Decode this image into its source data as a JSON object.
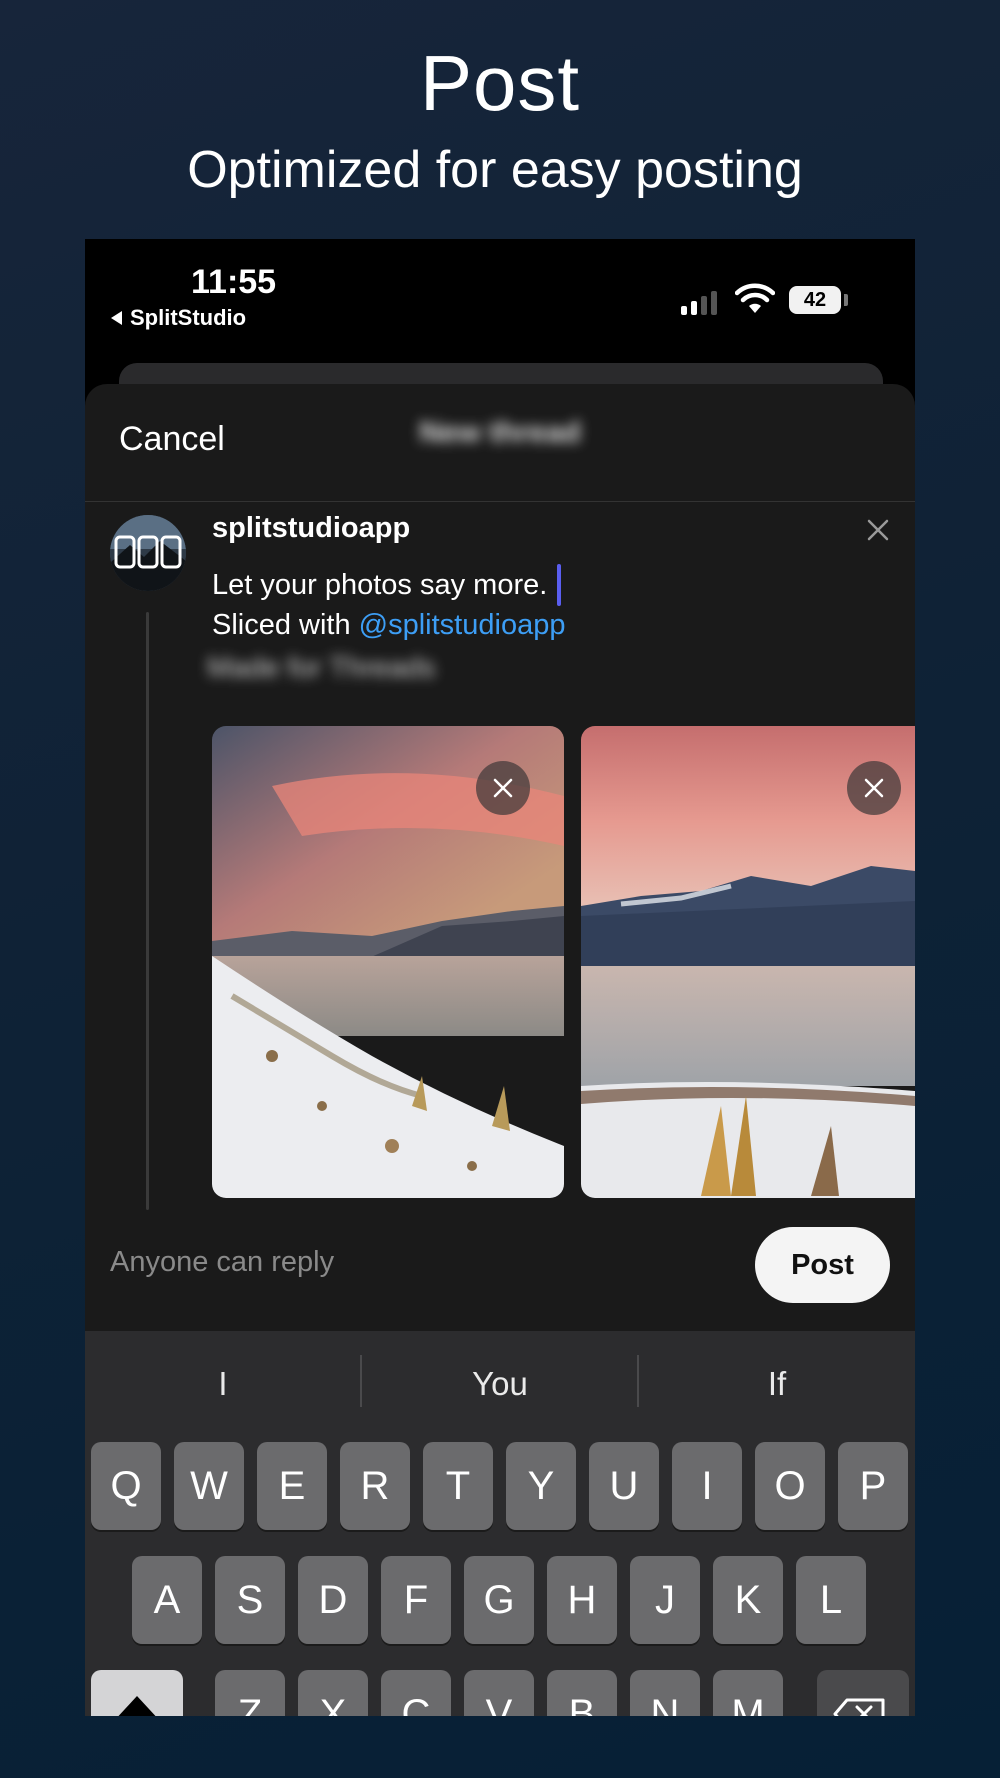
{
  "hero": {
    "title": "Post",
    "subtitle": "Optimized for easy posting"
  },
  "status_bar": {
    "time": "11:55",
    "back_app": "SplitStudio",
    "battery": "42"
  },
  "sheet": {
    "cancel_label": "Cancel",
    "title_blurred": "New thread"
  },
  "post": {
    "username": "splitstudioapp",
    "line1": "Let your photos say more.",
    "line2_prefix": "Sliced with ",
    "mention": "@splitstudioapp",
    "line3_blurred": "Made for Threads"
  },
  "footer": {
    "reply_label": "Anyone can reply",
    "post_label": "Post"
  },
  "keyboard": {
    "suggestions": [
      "I",
      "You",
      "If"
    ],
    "row1": [
      "Q",
      "W",
      "E",
      "R",
      "T",
      "Y",
      "U",
      "I",
      "O",
      "P"
    ],
    "row2": [
      "A",
      "S",
      "D",
      "F",
      "G",
      "H",
      "J",
      "K",
      "L"
    ],
    "row3": [
      "Z",
      "X",
      "C",
      "V",
      "B",
      "N",
      "M"
    ]
  },
  "colors": {
    "accent": "#3d9ef5",
    "caret": "#5a5ef0",
    "sheet_bg": "#1a1a1a",
    "keyboard_bg": "#2c2c2e"
  }
}
